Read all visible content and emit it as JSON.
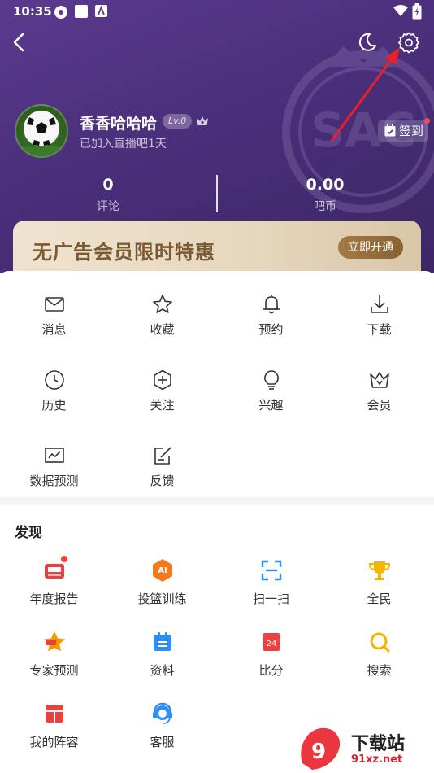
{
  "status_bar": {
    "time": "10:35"
  },
  "header": {
    "username": "香香哈哈哈",
    "level": "Lv.0",
    "joined_text": "已加入直播吧1天",
    "sign_in_label": "签到",
    "stats": [
      {
        "value": "0",
        "label": "评论"
      },
      {
        "value": "0.00",
        "label": "吧币"
      }
    ]
  },
  "vip_banner": {
    "title": "无广告会员限时特惠",
    "button_label": "立即开通",
    "colors": {
      "text": "#7a5a33",
      "button": "#9a7040"
    }
  },
  "grid": [
    {
      "label": "消息",
      "icon": "mail-icon"
    },
    {
      "label": "收藏",
      "icon": "star-icon"
    },
    {
      "label": "预约",
      "icon": "bell-icon"
    },
    {
      "label": "下载",
      "icon": "download-icon"
    },
    {
      "label": "历史",
      "icon": "clock-icon"
    },
    {
      "label": "关注",
      "icon": "hexagon-plus-icon"
    },
    {
      "label": "兴趣",
      "icon": "lightbulb-icon"
    },
    {
      "label": "会员",
      "icon": "crown-icon"
    },
    {
      "label": "数据预测",
      "icon": "chart-icon"
    },
    {
      "label": "反馈",
      "icon": "edit-icon"
    }
  ],
  "discover": {
    "title": "发现",
    "items": [
      {
        "label": "年度报告",
        "icon": "report-icon"
      },
      {
        "label": "投篮训练",
        "icon": "ai-badge-icon"
      },
      {
        "label": "扫一扫",
        "icon": "scan-icon"
      },
      {
        "label": "全民",
        "icon": "trophy-icon"
      },
      {
        "label": "专家预测",
        "icon": "expert-star-icon"
      },
      {
        "label": "资料",
        "icon": "calendar-icon"
      },
      {
        "label": "比分",
        "icon": "score-icon"
      },
      {
        "label": "搜索",
        "icon": "search-icon"
      },
      {
        "label": "我的阵容",
        "icon": "lineup-icon"
      },
      {
        "label": "客服",
        "icon": "headset-icon"
      }
    ]
  },
  "colors": {
    "header_purple": "#4a2f7a",
    "accent_orange": "#f39800",
    "accent_red": "#e64340",
    "accent_blue": "#2e8ef2",
    "accent_gold": "#f2b600"
  },
  "watermark": {
    "text": "下载站",
    "url_text": "91xz.net"
  }
}
